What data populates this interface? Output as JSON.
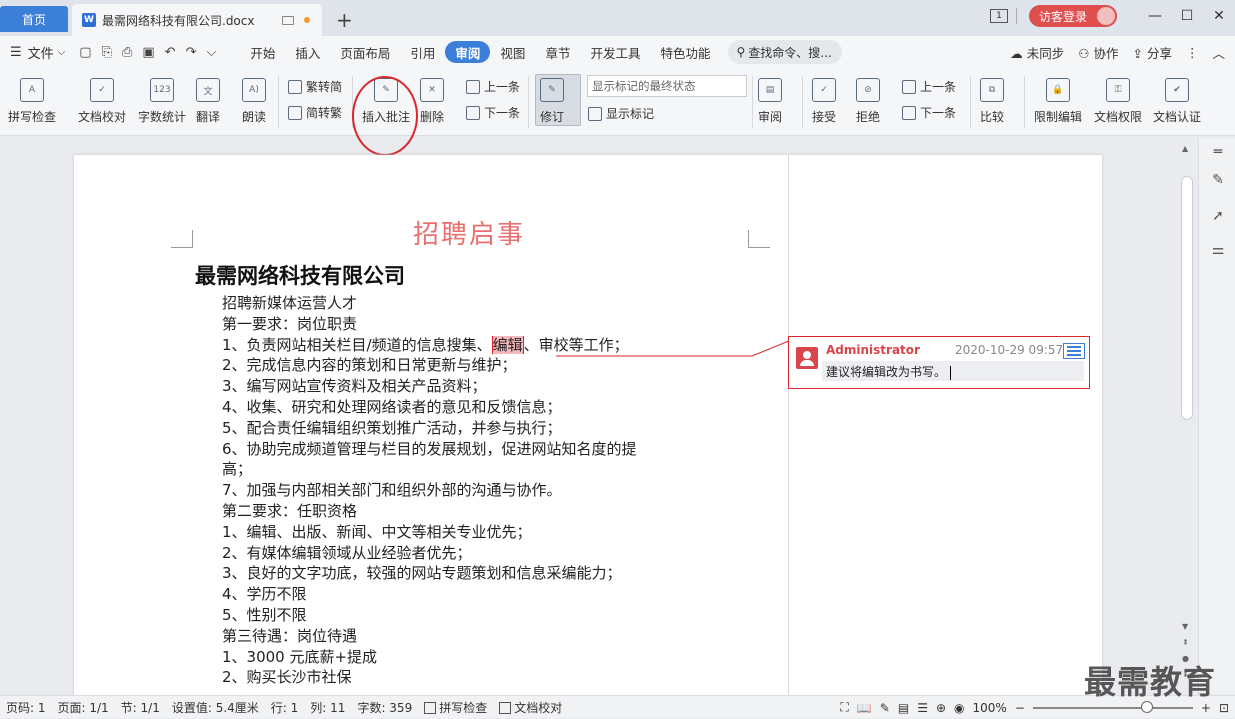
{
  "tabs": {
    "home": "首页",
    "doc_title": "最需网络科技有限公司.docx",
    "doc_icon": "W",
    "new_tab": "+"
  },
  "window": {
    "badge": "1",
    "guest": "访客登录",
    "minimize": "—",
    "restore": "☐",
    "close": "✕"
  },
  "menubar": {
    "file": "文件",
    "tabs": [
      "开始",
      "插入",
      "页面布局",
      "引用",
      "审阅",
      "视图",
      "章节",
      "开发工具",
      "特色功能"
    ],
    "active_tab": "审阅",
    "search": "查找命令、搜...",
    "right": [
      "未同步",
      "协作",
      "分享"
    ]
  },
  "ribbon": {
    "spell_check": "拼写检查",
    "doc_proof": "文档校对",
    "word_count": "字数统计",
    "translate": "翻译",
    "read_aloud": "朗读",
    "trad_to_simp": "繁转简",
    "simp_to_trad": "简转繁",
    "insert_comment": "插入批注",
    "delete": "删除",
    "prev": "上一条",
    "next": "下一条",
    "track": "修订",
    "markup_state": "显示标记的最终状态",
    "show_markup": "显示标记",
    "review": "审阅",
    "accept": "接受",
    "reject": "拒绝",
    "prev2": "上一条",
    "next2": "下一条",
    "compare": "比较",
    "restrict_edit": "限制编辑",
    "doc_permission": "文档权限",
    "doc_auth": "文档认证",
    "icon_text_123": "123"
  },
  "document": {
    "title": "招聘启事",
    "company": "最需网络科技有限公司",
    "lines": [
      "招聘新媒体运营人才",
      "第一要求：岗位职责",
      "",
      "2、完成信息内容的策划和日常更新与维护；",
      "3、编写网站宣传资料及相关产品资料；",
      "4、收集、研究和处理网络读者的意见和反馈信息；",
      "5、配合责任编辑组织策划推广活动，并参与执行；",
      "6、协助完成频道管理与栏目的发展规划，促进网站知名度的提",
      "高；",
      "7、加强与内部相关部门和组织外部的沟通与协作。",
      "第二要求：任职资格",
      "1、编辑、出版、新闻、中文等相关专业优先；",
      "2、有媒体编辑领域从业经验者优先；",
      "3、良好的文字功底，较强的网站专题策划和信息采编能力；",
      "4、学历不限",
      "5、性别不限",
      "第三待遇：岗位待遇",
      "1、3000 元底薪+提成",
      "2、购买长沙市社保"
    ],
    "line3_pre": "1、负责网站相关栏目/频道的信息搜集、",
    "line3_hl": "编辑",
    "line3_post": "、审校等工作；"
  },
  "comment": {
    "author": "Administrator",
    "time": "2020-10-29 09:57",
    "text": "建议将编辑改为书写。"
  },
  "statusbar": {
    "page_no": "页码: 1",
    "page": "页面: 1/1",
    "section": "节: 1/1",
    "setting": "设置值: 5.4厘米",
    "row": "行: 1",
    "col": "列: 11",
    "word_count": "字数: 359",
    "spell": "拼写检查",
    "proof": "文档校对",
    "zoom": "100%"
  },
  "watermark": "最需教育",
  "colors": {
    "accent": "#3b7fd9",
    "comment_red": "#d9262b",
    "title_pink": "#e97070"
  }
}
